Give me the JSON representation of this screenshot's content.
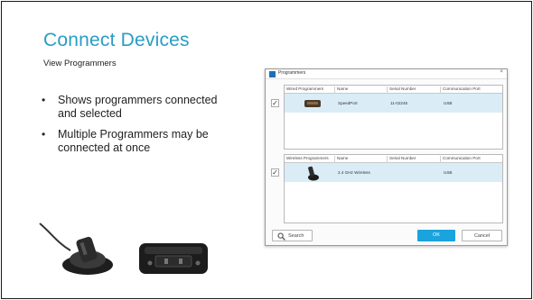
{
  "slide": {
    "title": "Connect Devices",
    "subtitle": "View Programmers",
    "bullets": [
      "Shows programmers connected and selected",
      "Multiple Programmers may be connected at once"
    ]
  },
  "dialog": {
    "title": "Programmers",
    "close": "×",
    "wired": {
      "columns": [
        "Wired Programmers",
        "Name",
        "Serial Number",
        "Communication Port"
      ],
      "row": {
        "checked": "✓",
        "name": "SpeedPort",
        "serial": "11-02245",
        "port": "USB"
      }
    },
    "wireless": {
      "columns": [
        "Wireless Programmers",
        "Name",
        "Serial Number",
        "Communication Port"
      ],
      "row": {
        "checked": "✓",
        "name": "2.4 GHz Wireless",
        "serial": "",
        "port": "USB"
      }
    },
    "search_label": "Search",
    "ok_label": "OK",
    "cancel_label": "Cancel"
  },
  "colors": {
    "accent": "#2a9cc7",
    "ok_button": "#1aa3dd",
    "selected_row": "#daedf7"
  }
}
